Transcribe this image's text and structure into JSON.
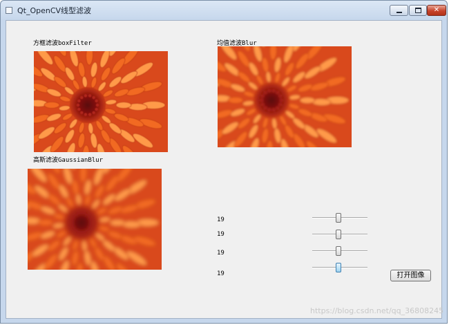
{
  "window": {
    "title": "Qt_OpenCV线型滤波",
    "controls": {
      "minimize_icon": "minimize-icon",
      "maximize_icon": "maximize-icon",
      "close_icon": "close-icon",
      "close_glyph": "✕"
    }
  },
  "panels": [
    {
      "label": "方框滤波boxFilter",
      "blur": 0.6
    },
    {
      "label": "均值滤波Blur",
      "blur": 1.6
    },
    {
      "label": "高斯滤波GaussianBlur",
      "blur": 2.6
    }
  ],
  "sliders": [
    {
      "value_label": "19",
      "level": 0.48
    },
    {
      "value_label": "19",
      "level": 0.48
    },
    {
      "value_label": "19",
      "level": 0.48
    },
    {
      "value_label": "19",
      "level": 0.48,
      "focused": true
    }
  ],
  "button": {
    "open_image": "打开图像"
  },
  "watermark": "https://blog.csdn.net/qq_36808245",
  "colors": {
    "petal": "#f26a21",
    "petal_light": "#ff9a4a",
    "center": "#8a1210"
  }
}
